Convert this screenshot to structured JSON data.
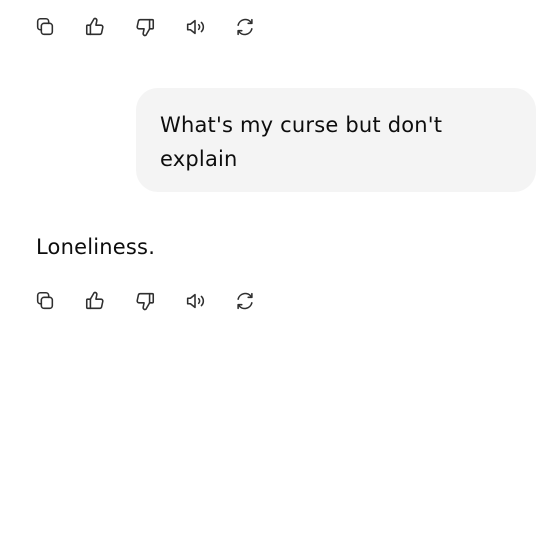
{
  "conversation": {
    "user_message": "What's my curse but don't explain",
    "assistant_message": "Loneliness."
  },
  "actions": {
    "copy_icon": "copy-icon",
    "like_icon": "thumbs-up-icon",
    "dislike_icon": "thumbs-down-icon",
    "read_aloud_icon": "speaker-icon",
    "regenerate_icon": "refresh-icon"
  },
  "colors": {
    "bubble_background": "#f4f4f4",
    "text": "#0d0d0d",
    "icon": "#2f2f2f"
  }
}
